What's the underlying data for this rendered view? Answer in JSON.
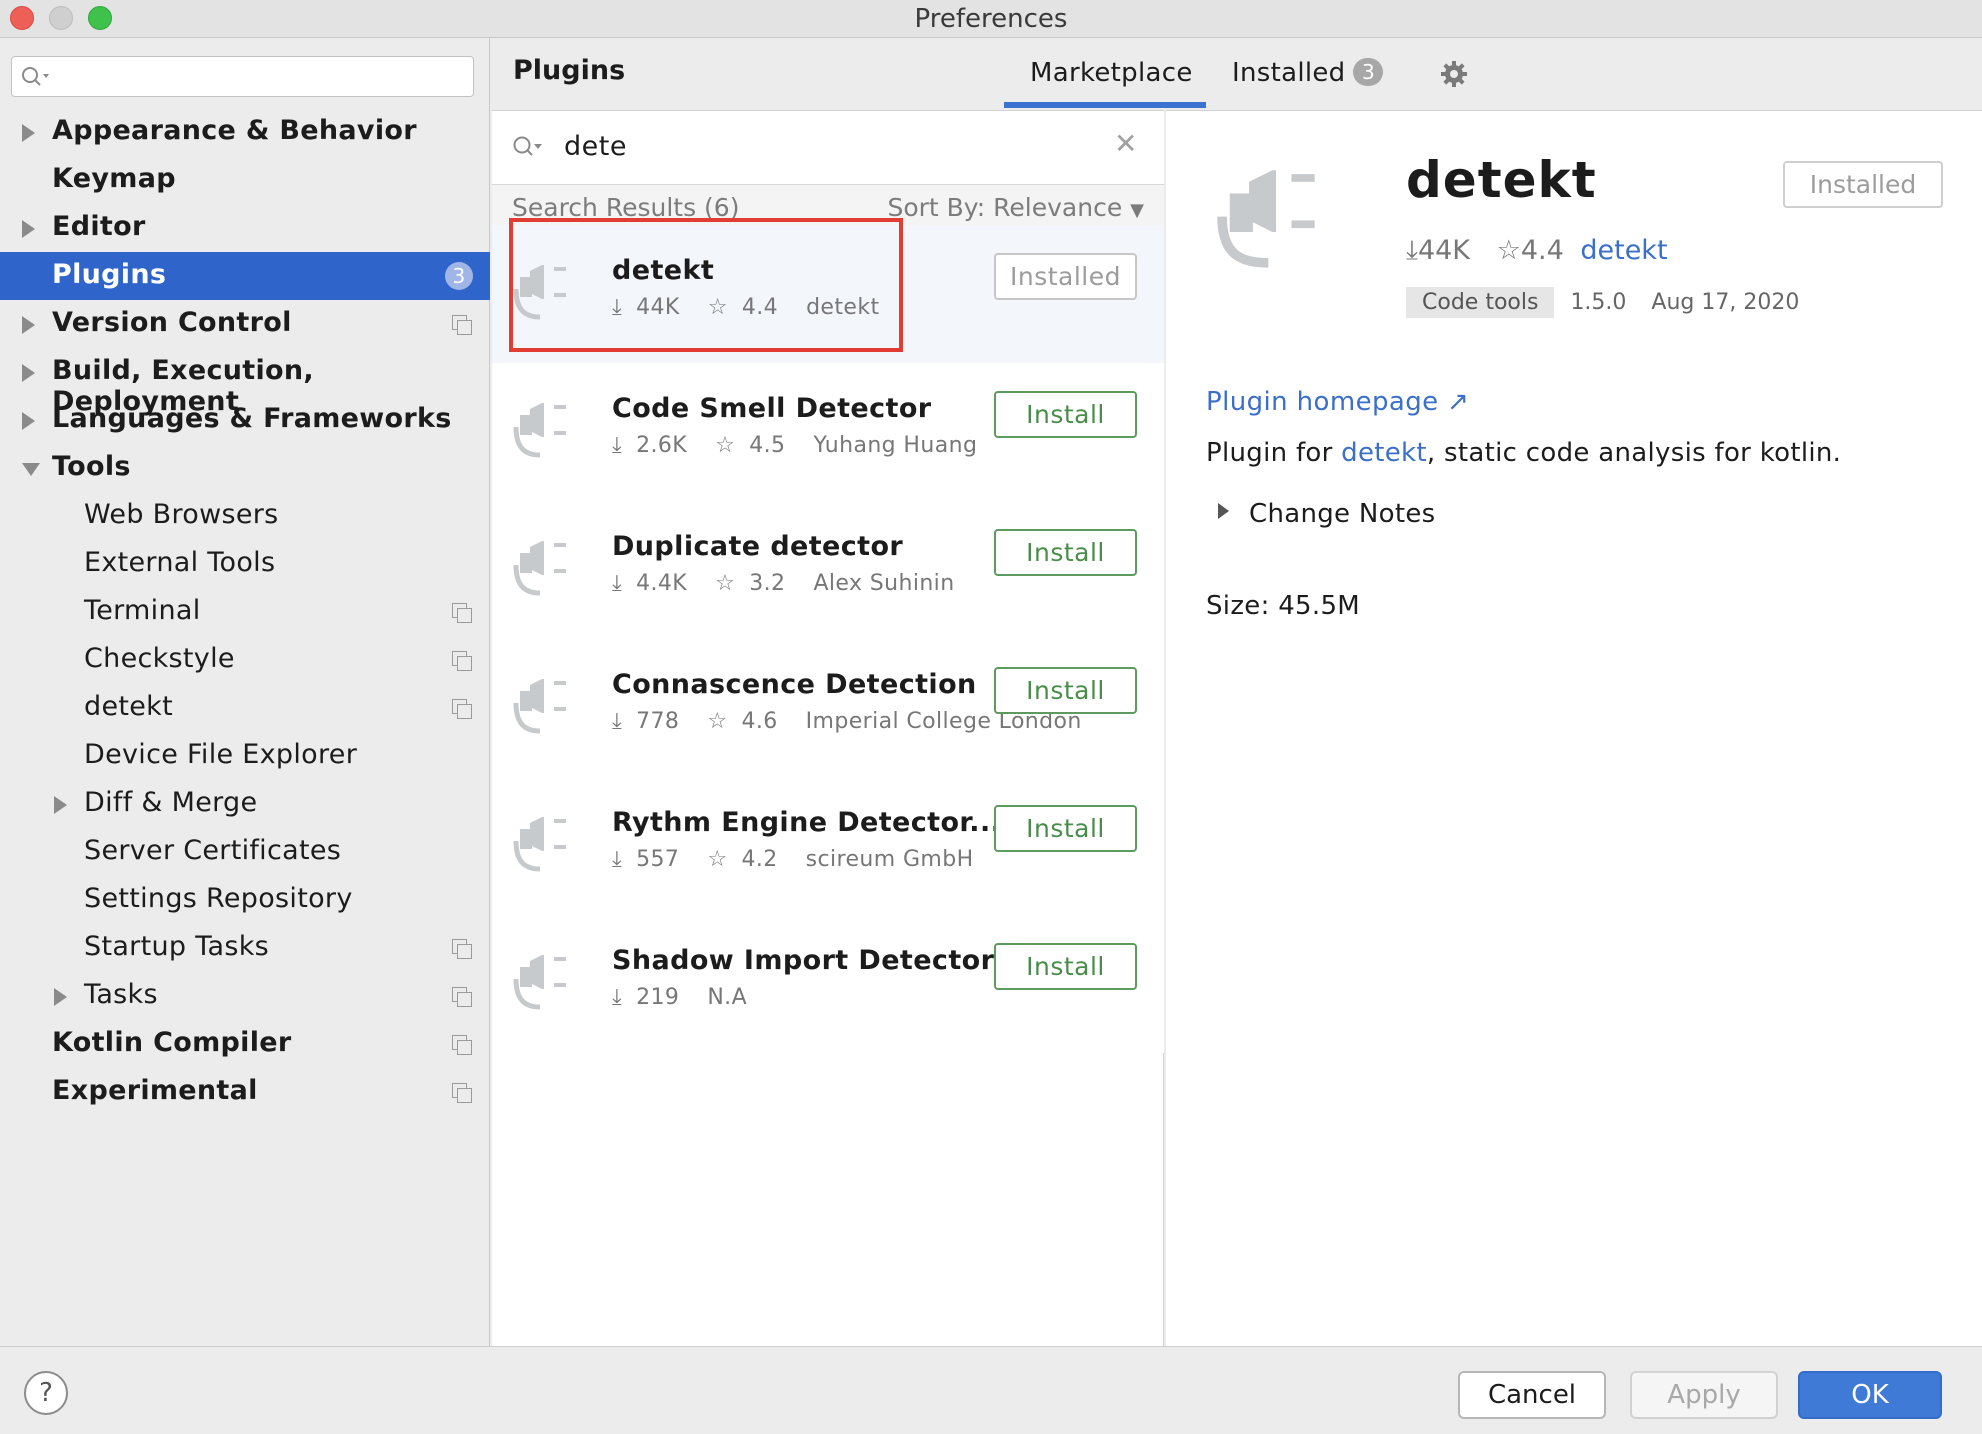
{
  "window": {
    "title": "Preferences"
  },
  "sidebar": {
    "search_placeholder": "",
    "items": [
      {
        "label": "Appearance & Behavior",
        "level": 0,
        "expand": "right"
      },
      {
        "label": "Keymap",
        "level": 0,
        "expand": "none"
      },
      {
        "label": "Editor",
        "level": 0,
        "expand": "right"
      },
      {
        "label": "Plugins",
        "level": 0,
        "expand": "none",
        "selected": true,
        "badge": "3"
      },
      {
        "label": "Version Control",
        "level": 0,
        "expand": "right",
        "copy_icon": true
      },
      {
        "label": "Build, Execution, Deployment",
        "level": 0,
        "expand": "right"
      },
      {
        "label": "Languages & Frameworks",
        "level": 0,
        "expand": "right"
      },
      {
        "label": "Tools",
        "level": 0,
        "expand": "down"
      },
      {
        "label": "Web Browsers",
        "level": 1,
        "expand": "none"
      },
      {
        "label": "External Tools",
        "level": 1,
        "expand": "none"
      },
      {
        "label": "Terminal",
        "level": 1,
        "expand": "none",
        "copy_icon": true
      },
      {
        "label": "Checkstyle",
        "level": 1,
        "expand": "none",
        "copy_icon": true
      },
      {
        "label": "detekt",
        "level": 1,
        "expand": "none",
        "copy_icon": true
      },
      {
        "label": "Device File Explorer",
        "level": 1,
        "expand": "none"
      },
      {
        "label": "Diff & Merge",
        "level": 1,
        "expand": "right"
      },
      {
        "label": "Server Certificates",
        "level": 1,
        "expand": "none"
      },
      {
        "label": "Settings Repository",
        "level": 1,
        "expand": "none"
      },
      {
        "label": "Startup Tasks",
        "level": 1,
        "expand": "none",
        "copy_icon": true
      },
      {
        "label": "Tasks",
        "level": 1,
        "expand": "right",
        "copy_icon": true
      },
      {
        "label": "Kotlin Compiler",
        "level": 0,
        "expand": "none",
        "copy_icon": true
      },
      {
        "label": "Experimental",
        "level": 0,
        "expand": "none",
        "copy_icon": true
      }
    ]
  },
  "header": {
    "title": "Plugins",
    "tabs": {
      "marketplace": "Marketplace",
      "installed": "Installed",
      "installed_count": "3"
    }
  },
  "search": {
    "value": "dete"
  },
  "results": {
    "count_label": "Search Results (6)",
    "sort_label": "Sort By: Relevance",
    "plugins": [
      {
        "name": "detekt",
        "downloads": "44K",
        "rating": "4.4",
        "vendor": "detekt",
        "button": "Installed",
        "state": "installed"
      },
      {
        "name": "Code Smell Detector",
        "downloads": "2.6K",
        "rating": "4.5",
        "vendor": "Yuhang Huang",
        "button": "Install",
        "state": "install"
      },
      {
        "name": "Duplicate detector",
        "downloads": "4.4K",
        "rating": "3.2",
        "vendor": "Alex Suhinin",
        "button": "Install",
        "state": "install"
      },
      {
        "name": "Connascence Detection",
        "downloads": "778",
        "rating": "4.6",
        "vendor": "Imperial College London",
        "button": "Install",
        "state": "install"
      },
      {
        "name": "Rythm Engine Detector...",
        "downloads": "557",
        "rating": "4.2",
        "vendor": "scireum GmbH",
        "button": "Install",
        "state": "install"
      },
      {
        "name": "Shadow Import Detector",
        "downloads": "219",
        "rating": "",
        "vendor": "N.A",
        "button": "Install",
        "state": "install"
      }
    ]
  },
  "detail": {
    "name": "detekt",
    "button": "Installed",
    "downloads": "44K",
    "rating": "4.4",
    "vendor": "detekt",
    "tag": "Code tools",
    "version": "1.5.0",
    "date": "Aug 17, 2020",
    "homepage": "Plugin homepage ↗",
    "desc_prefix": "Plugin for ",
    "desc_link": "detekt",
    "desc_suffix": ", static code analysis for kotlin.",
    "change_notes": "Change Notes",
    "size": "Size: 45.5M"
  },
  "footer": {
    "cancel": "Cancel",
    "apply": "Apply",
    "ok": "OK",
    "help": "?"
  },
  "colors": {
    "accent": "#2f65ca",
    "install_green": "#4a8d4a",
    "link": "#3b6fc9",
    "highlight": "#e13d33"
  }
}
